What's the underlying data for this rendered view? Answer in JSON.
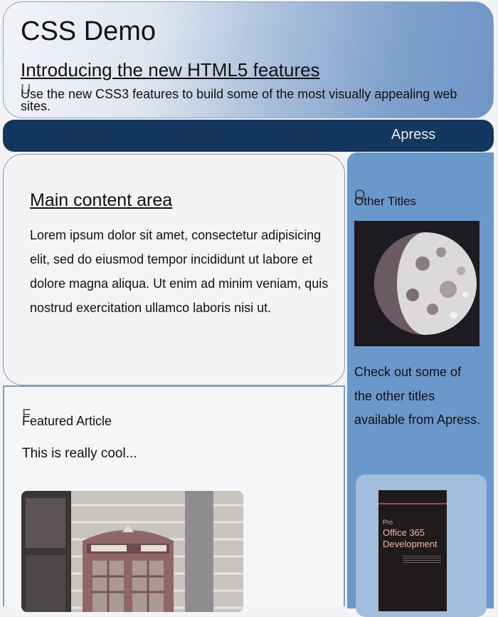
{
  "header": {
    "title": "CSS Demo",
    "subtitle": "Introducing the new HTML5 features",
    "ghost_letter": "U",
    "tagline": "Use the new CSS3 features to build some of the most visually appealing web sites."
  },
  "nav": {
    "items": [
      {
        "label": "Feature"
      },
      {
        "label": "Articles"
      },
      {
        "label": "Archives"
      },
      {
        "label": "Apress"
      }
    ],
    "active_index": 3
  },
  "main": {
    "heading": "Main content area",
    "body": "Lorem ipsum dolor sit amet, consectetur adipisicing elit, sed do eiusmod tempor incididunt ut labore et dolore magna aliqua. Ut enim ad minim veniam, quis nostrud exercitation ullamco laboris nisi ut."
  },
  "featured": {
    "ghost_letter": "F",
    "heading": "Featured Article",
    "intro": "This is really cool..."
  },
  "sidebar": {
    "ghost_letter": "O",
    "heading": "Other Titles",
    "promo": "Check out some of the other titles available from Apress.",
    "book": {
      "kicker": "Pro",
      "title": "Office 365 Development"
    }
  },
  "colors": {
    "nav_bg": "#14375f",
    "sidebar_bg": "#6b98cb",
    "header_gradient_end": "#6f95c7"
  }
}
